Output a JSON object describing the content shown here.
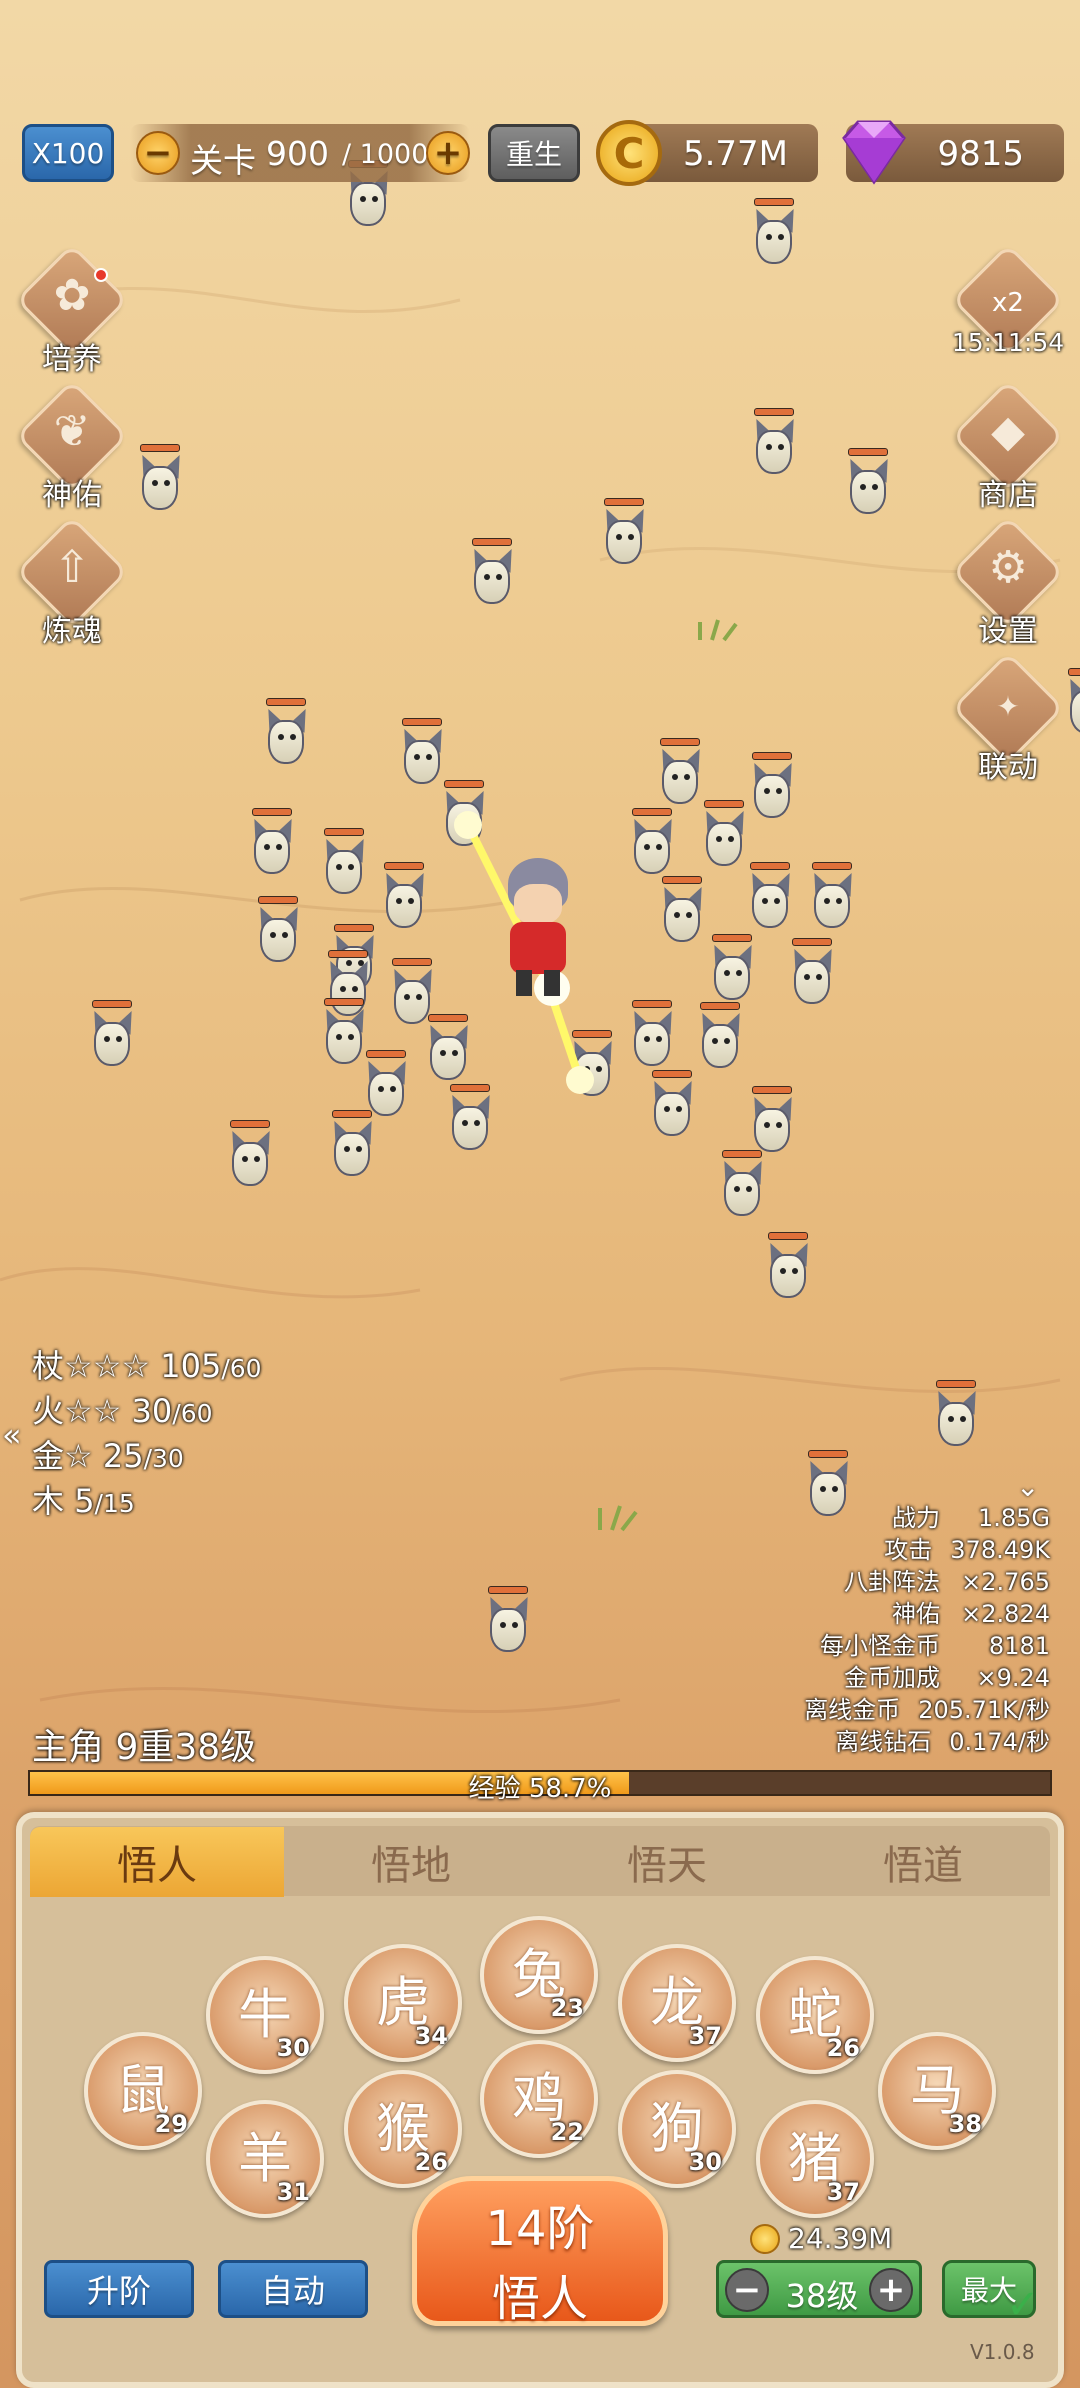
{
  "top_bar": {
    "speed_label": "X100",
    "stage_prefix": "关卡",
    "stage_current": "900",
    "stage_total": "/ 1000",
    "rebirth_label": "重生",
    "coins": "5.77M",
    "gems": "9815"
  },
  "left_menu": [
    {
      "label": "培养",
      "icon": "cultivate-icon"
    },
    {
      "label": "神佑",
      "icon": "blessing-icon"
    },
    {
      "label": "炼魂",
      "icon": "soul-refine-icon"
    }
  ],
  "right_menu": {
    "bonus_label": "x2",
    "bonus_timer": "15:11:54",
    "items": [
      {
        "label": "商店",
        "icon": "shop-icon"
      },
      {
        "label": "设置",
        "icon": "settings-icon"
      },
      {
        "label": "联动",
        "icon": "collab-icon"
      }
    ]
  },
  "weapon_stats": [
    {
      "name": "杖☆☆☆",
      "value": "105",
      "max": "/60"
    },
    {
      "name": "火☆☆",
      "value": "30",
      "max": "/60"
    },
    {
      "name": "金☆",
      "value": "25",
      "max": "/30"
    },
    {
      "name": "木",
      "value": "5",
      "max": "/15"
    }
  ],
  "player_stats": [
    {
      "label": "战力",
      "value": "1.85G"
    },
    {
      "label": "攻击",
      "value": "378.49K"
    },
    {
      "label": "八卦阵法",
      "value": "×2.765"
    },
    {
      "label": "神佑",
      "value": "×2.824"
    },
    {
      "label": "每小怪金币",
      "value": "8181"
    },
    {
      "label": "金币加成",
      "value": "×9.24"
    },
    {
      "label": "离线金币",
      "value": "205.71K/秒"
    },
    {
      "label": "离线钻石",
      "value": "0.174/秒"
    }
  ],
  "hero": {
    "title": "主角 9重38级",
    "exp_label": "经验 58.7%",
    "exp_progress": 0.587
  },
  "tabs": [
    "悟人",
    "悟地",
    "悟天",
    "悟道"
  ],
  "active_tab": 0,
  "zodiac": [
    {
      "name": "rat",
      "icon": "rat-icon",
      "glyph": "鼠",
      "level": "29"
    },
    {
      "name": "ox",
      "icon": "ox-icon",
      "glyph": "牛",
      "level": "30"
    },
    {
      "name": "goat",
      "icon": "goat-icon",
      "glyph": "羊",
      "level": "31"
    },
    {
      "name": "tiger",
      "icon": "tiger-icon",
      "glyph": "虎",
      "level": "34"
    },
    {
      "name": "monkey",
      "icon": "monkey-icon",
      "glyph": "猴",
      "level": "26"
    },
    {
      "name": "rabbit",
      "icon": "rabbit-icon",
      "glyph": "兔",
      "level": "23"
    },
    {
      "name": "rooster",
      "icon": "rooster-icon",
      "glyph": "鸡",
      "level": "22"
    },
    {
      "name": "dragon",
      "icon": "dragon-icon",
      "glyph": "龙",
      "level": "37"
    },
    {
      "name": "dog",
      "icon": "dog-icon",
      "glyph": "狗",
      "level": "30"
    },
    {
      "name": "snake",
      "icon": "snake-icon",
      "glyph": "蛇",
      "level": "26"
    },
    {
      "name": "pig",
      "icon": "pig-icon",
      "glyph": "猪",
      "level": "37"
    },
    {
      "name": "horse",
      "icon": "horse-icon",
      "glyph": "马",
      "level": "38"
    }
  ],
  "bottom": {
    "upgrade_label": "升阶",
    "auto_label": "自动",
    "rank_line1": "14阶",
    "rank_line2": "悟人",
    "cost": "24.39M",
    "level_label": "38级",
    "max_label": "最大",
    "version": "V1.0.8"
  },
  "colors": {
    "gold": "#f5a623",
    "exp_track": "#5a3e2a",
    "tab_active": "#f2b640",
    "button_blue": "#3a7cc0",
    "button_green": "#4aa050"
  }
}
